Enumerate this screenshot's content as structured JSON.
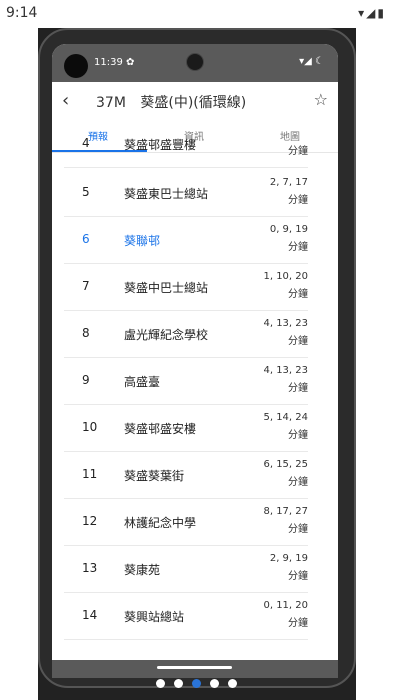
{
  "outer_status": {
    "time": "9:14",
    "icons": "▾◢▮"
  },
  "inner_status": {
    "time": "11:39 ✿",
    "icons": "▾◢ ☾"
  },
  "appbar": {
    "back": "‹",
    "route": "37M",
    "title": "葵盛(中)(循環線)",
    "star": "☆"
  },
  "tabs": [
    "預報",
    "資訊",
    "地圖"
  ],
  "stops": [
    {
      "num": "4",
      "name": "葵盛邨盛豐樓",
      "eta": "",
      "unit": "分鐘"
    },
    {
      "num": "5",
      "name": "葵盛東巴士總站",
      "eta": "2, 7, 17",
      "unit": "分鐘"
    },
    {
      "num": "6",
      "name": "葵聯邨",
      "eta": "0, 9, 19",
      "unit": "分鐘"
    },
    {
      "num": "7",
      "name": "葵盛中巴士總站",
      "eta": "1, 10, 20",
      "unit": "分鐘"
    },
    {
      "num": "8",
      "name": "盧光輝紀念學校",
      "eta": "4, 13, 23",
      "unit": "分鐘"
    },
    {
      "num": "9",
      "name": "高盛臺",
      "eta": "4, 13, 23",
      "unit": "分鐘"
    },
    {
      "num": "10",
      "name": "葵盛邨盛安樓",
      "eta": "5, 14, 24",
      "unit": "分鐘"
    },
    {
      "num": "11",
      "name": "葵盛葵葉街",
      "eta": "6, 15, 25",
      "unit": "分鐘"
    },
    {
      "num": "12",
      "name": "林護紀念中學",
      "eta": "8, 17, 27",
      "unit": "分鐘"
    },
    {
      "num": "13",
      "name": "葵康苑",
      "eta": "2, 9, 19",
      "unit": "分鐘"
    },
    {
      "num": "14",
      "name": "葵興站總站",
      "eta": "0, 11, 20",
      "unit": "分鐘"
    }
  ],
  "highlight_color": "#1a73e8"
}
